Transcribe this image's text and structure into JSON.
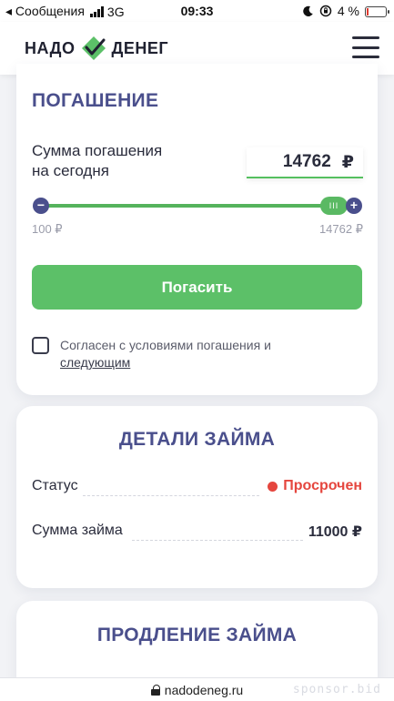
{
  "status_bar": {
    "carrier": "◂ Сообщения",
    "network": "3G",
    "time": "09:33",
    "battery": "4 %"
  },
  "header": {
    "logo_left": "НАДО",
    "logo_right": "ДЕНЕГ"
  },
  "repayment": {
    "title": "ПОГАШЕНИЕ",
    "sum_label_line1": "Сумма погашения",
    "sum_label_line2": "на сегодня",
    "amount": "14762",
    "currency": "₽",
    "slider_min_label": "100 ₽",
    "slider_max_label": "14762 ₽",
    "slider_level": 1.0,
    "pay_button": "Погасить",
    "agree_text": "Согласен с условиями погашения и",
    "agree_link": "следующим",
    "agree_checked": false
  },
  "loan_details": {
    "title": "ДЕТАЛИ ЗАЙМА",
    "rows": [
      {
        "label": "Статус",
        "value": "Просрочен",
        "status": "overdue"
      },
      {
        "label": "Сумма займа",
        "value": "11000 ₽"
      }
    ]
  },
  "extension": {
    "title": "ПРОДЛЕНИЕ ЗАЙМА"
  },
  "url_bar": {
    "url": "nadodeneg.ru",
    "watermark": "sponsor.bid"
  },
  "colors": {
    "accent_blue": "#4a4f8c",
    "accent_green": "#5cc068",
    "status_red": "#e5463e"
  }
}
